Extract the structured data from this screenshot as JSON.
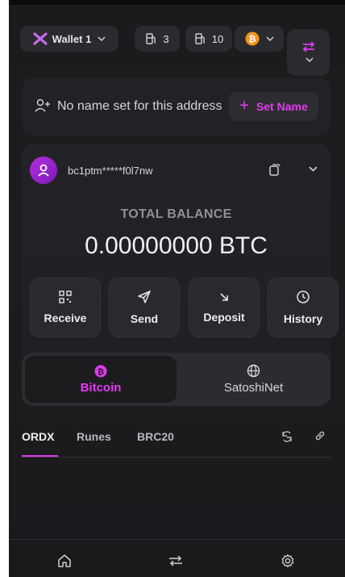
{
  "topbar": {
    "wallet_label": "Wallet 1",
    "count_a": "3",
    "count_b": "10"
  },
  "name_card": {
    "message": "No name set for this address",
    "button_label": "Set Name",
    "button_plus": "+"
  },
  "address": {
    "value": "bc1ptm*****f0l7nw"
  },
  "balance": {
    "label": "TOTAL BALANCE",
    "value": "0.00000000 BTC"
  },
  "actions": [
    {
      "label": "Receive",
      "icon": "qr-code-icon"
    },
    {
      "label": "Send",
      "icon": "send-icon"
    },
    {
      "label": "Deposit",
      "icon": "deposit-arrow-icon"
    },
    {
      "label": "History",
      "icon": "clock-icon"
    }
  ],
  "networks": [
    {
      "label": "Bitcoin",
      "icon": "bitcoin-icon",
      "selected": true
    },
    {
      "label": "SatoshiNet",
      "icon": "globe-icon",
      "selected": false
    }
  ],
  "asset_tabs": [
    {
      "label": "ORDX",
      "active": true
    },
    {
      "label": "Runes",
      "active": false
    },
    {
      "label": "BRC20",
      "active": false
    }
  ],
  "colors": {
    "accent": "#e23bf0",
    "bitcoin_orange": "#f7931a",
    "background": "#1c1c1f"
  },
  "bottom_nav": [
    {
      "name": "home",
      "icon": "home-icon"
    },
    {
      "name": "swap",
      "icon": "swap-icon"
    },
    {
      "name": "settings",
      "icon": "gear-icon"
    }
  ]
}
